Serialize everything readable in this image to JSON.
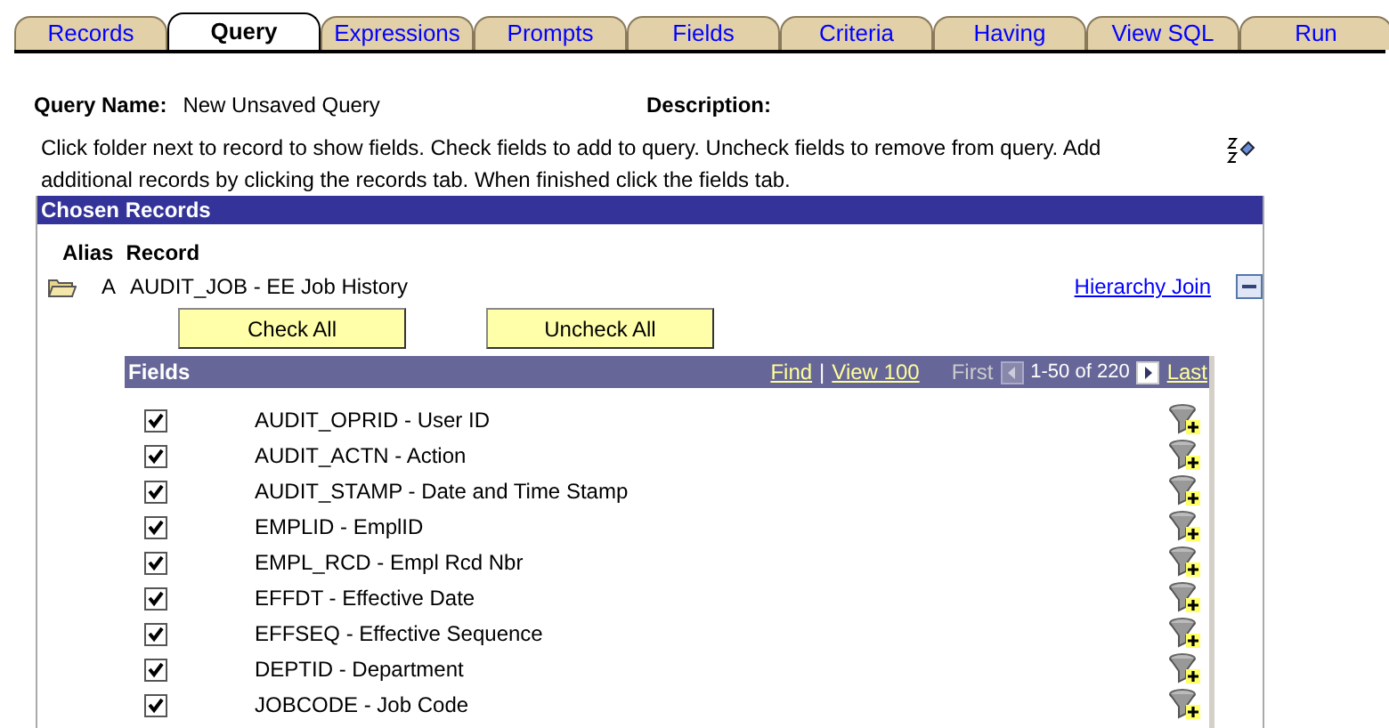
{
  "tabs": [
    {
      "label": "Records",
      "selected": false
    },
    {
      "label": "Query",
      "selected": true
    },
    {
      "label": "Expressions",
      "selected": false
    },
    {
      "label": "Prompts",
      "selected": false
    },
    {
      "label": "Fields",
      "selected": false
    },
    {
      "label": "Criteria",
      "selected": false
    },
    {
      "label": "Having",
      "selected": false
    },
    {
      "label": "View SQL",
      "selected": false
    },
    {
      "label": "Run",
      "selected": false
    }
  ],
  "query_name": {
    "label": "Query Name:",
    "value": "New Unsaved Query"
  },
  "description": {
    "label": "Description:"
  },
  "instructions": "Click folder next to record to show fields. Check fields to add to query. Uncheck fields to remove from query. Add additional records by clicking the records tab. When finished click the fields tab.",
  "chosen_records": {
    "title": "Chosen Records",
    "columns": [
      "Alias",
      "Record"
    ],
    "record": {
      "alias": "A",
      "name": "AUDIT_JOB - EE Job History",
      "link": "Hierarchy Join"
    },
    "buttons": [
      "Check All",
      "Uncheck All"
    ],
    "fields": {
      "title": "Fields",
      "find": "Find",
      "separator": "|",
      "view": "View 100",
      "first": "First",
      "range": "1-50 of 220",
      "last": "Last",
      "rows": [
        {
          "checked": true,
          "label": "AUDIT_OPRID - User ID"
        },
        {
          "checked": true,
          "label": "AUDIT_ACTN - Action"
        },
        {
          "checked": true,
          "label": "AUDIT_STAMP - Date and Time Stamp"
        },
        {
          "checked": true,
          "label": "EMPLID - EmplID"
        },
        {
          "checked": true,
          "label": "EMPL_RCD - Empl Rcd Nbr"
        },
        {
          "checked": true,
          "label": "EFFDT - Effective Date"
        },
        {
          "checked": true,
          "label": "EFFSEQ - Effective Sequence"
        },
        {
          "checked": true,
          "label": "DEPTID - Department"
        },
        {
          "checked": true,
          "label": "JOBCODE - Job Code"
        }
      ]
    }
  }
}
